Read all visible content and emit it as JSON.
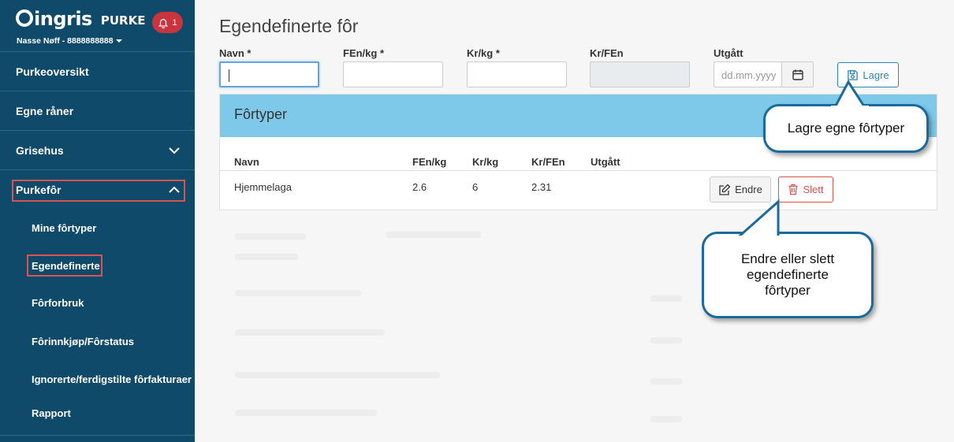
{
  "sidebar": {
    "brand": "ingris",
    "product": "PURKE",
    "notifications": "1",
    "user": "Nasse Nøff - 8888888888",
    "items": [
      {
        "label": "Purkeoversikt"
      },
      {
        "label": "Egne råner"
      },
      {
        "label": "Grisehus"
      },
      {
        "label": "Purkefôr"
      }
    ],
    "subitems": [
      {
        "label": "Mine fôrtyper"
      },
      {
        "label": "Egendefinerte"
      },
      {
        "label": "Fôrforbruk"
      },
      {
        "label": "Fôrinnkjøp/Fôrstatus"
      },
      {
        "label": "Ignorerte/ferdigstilte fôrfakturaer"
      },
      {
        "label": "Rapport"
      }
    ]
  },
  "page": {
    "title": "Egendefinerte fôr"
  },
  "form": {
    "navn_label": "Navn *",
    "fen_label": "FEn/kg *",
    "kr_label": "Kr/kg *",
    "krfen_label": "Kr/FEn",
    "utgatt_label": "Utgått",
    "date_placeholder": "dd.mm.yyyy",
    "save_label": "Lagre"
  },
  "table": {
    "title": "Fôrtyper",
    "headers": [
      "Navn",
      "FEn/kg",
      "Kr/kg",
      "Kr/FEn",
      "Utgått"
    ],
    "rows": [
      {
        "navn": "Hjemmelaga",
        "fen": "2.6",
        "kr": "6",
        "krfen": "2.31",
        "utgatt": ""
      }
    ],
    "edit_label": "Endre",
    "delete_label": "Slett"
  },
  "callouts": {
    "save": "Lagre egne fôrtyper",
    "edit_delete": "Endre eller slett egendefinerte fôrtyper"
  },
  "colors": {
    "sidebar": "#0f4a6b",
    "panel_header": "#7ec8ea",
    "primary": "#2b86b8",
    "danger": "#d9534f"
  }
}
